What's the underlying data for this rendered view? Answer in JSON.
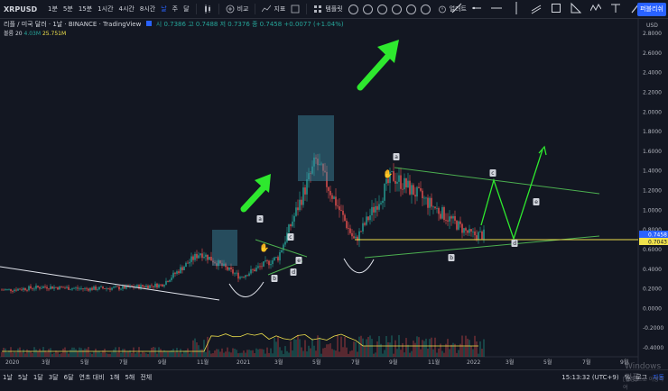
{
  "symbol": "XRPUSD",
  "timeframes": [
    "1분",
    "5분",
    "15분",
    "1시간",
    "4시간",
    "8시간",
    "날",
    "주",
    "달"
  ],
  "active_timeframe": "날",
  "toolbar": {
    "compare": "비교",
    "indicators": "지표",
    "template": "템플릿",
    "alert": "얼러트",
    "publish": "퍼블리쉬"
  },
  "info": {
    "pair": "리플 / 미국 달러 · 1날 · BINANCE · TradingView",
    "open": "시 0.7386",
    "high": "고 0.7488",
    "low": "저 0.7376",
    "close": "종 0.7458",
    "change": "+0.0077 (+1.04%)"
  },
  "volume": {
    "label": "볼륨 20",
    "v1": "4.03M",
    "v2": "25.751M"
  },
  "price_axis": {
    "currency": "USD",
    "ticks": [
      "2.8000",
      "2.6000",
      "2.4000",
      "2.2000",
      "2.0000",
      "1.8000",
      "1.6000",
      "1.4000",
      "1.2000",
      "1.0000",
      "0.8000",
      "0.6000",
      "0.4000",
      "0.2000",
      "0.0000",
      "-0.2000",
      "-0.4000"
    ],
    "price_tag": "0.7458",
    "level_tag": "0.7043"
  },
  "time_axis": [
    "2020",
    "3월",
    "5월",
    "7월",
    "9월",
    "11월",
    "2021",
    "3월",
    "5월",
    "7월",
    "9월",
    "11월",
    "2022",
    "3월",
    "5월",
    "7월",
    "9월"
  ],
  "pattern_labels": [
    "a",
    "b",
    "c",
    "d",
    "e",
    "a",
    "b",
    "c",
    "d",
    "e"
  ],
  "bottom": {
    "ranges": [
      "1날",
      "5날",
      "1달",
      "3달",
      "6달",
      "연초 대비",
      "1해",
      "5해",
      "전체"
    ],
    "clock": "15:13:32 (UTC+9)",
    "pct": "%",
    "log": "로그",
    "auto": "자동"
  },
  "watermark": {
    "line1": "Windows 정품",
    "line2": "[설정]으로 이동하여"
  },
  "colors": {
    "bg": "#131722",
    "accent": "#2962ff",
    "up": "#26a69a",
    "down": "#ef5350",
    "arrow": "#2ee82e",
    "pattern": "#4caf50",
    "yellow": "#f0e24c"
  },
  "chart_data": {
    "type": "candlestick",
    "title": "XRPUSD",
    "ylim": [
      -0.4,
      2.8
    ],
    "x": [
      "2020-01",
      "2020-03",
      "2020-05",
      "2020-07",
      "2020-09",
      "2020-11",
      "2021-01",
      "2021-03",
      "2021-05",
      "2021-07",
      "2021-09",
      "2021-11",
      "2022-01"
    ],
    "close": [
      0.19,
      0.22,
      0.2,
      0.21,
      0.24,
      0.57,
      0.32,
      0.52,
      1.5,
      0.68,
      1.35,
      1.05,
      0.75
    ]
  }
}
